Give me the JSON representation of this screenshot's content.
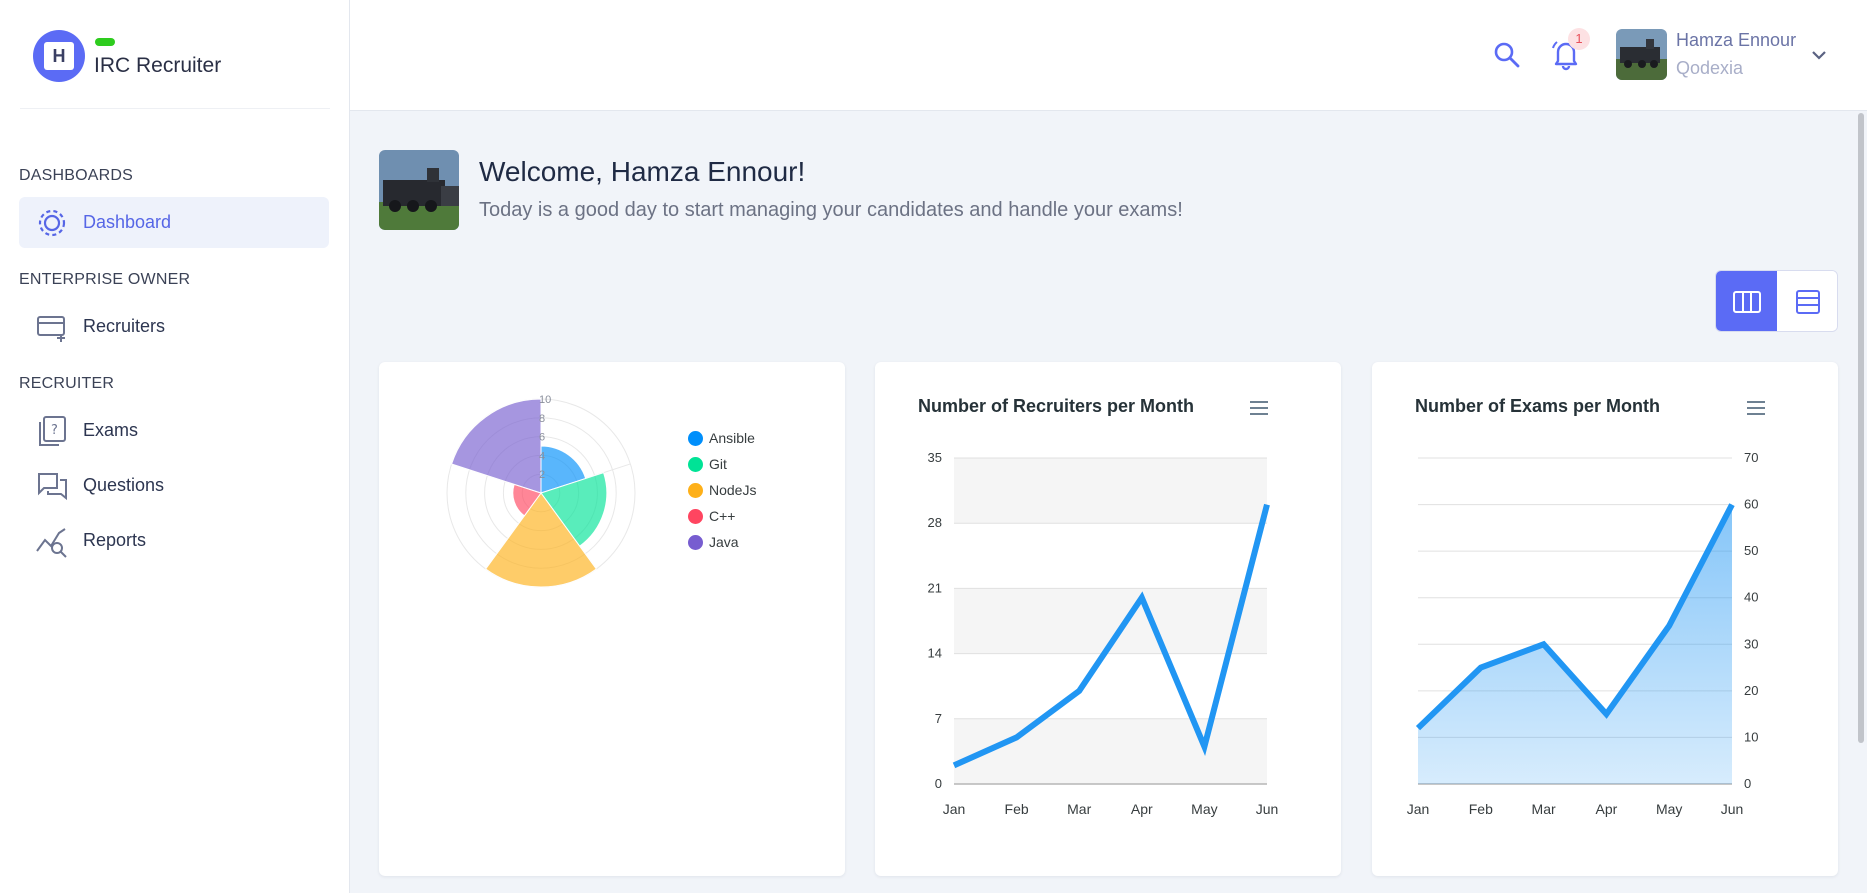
{
  "app": {
    "name": "IRC Recruiter"
  },
  "sidebar": {
    "sections": [
      {
        "title": "DASHBOARDS",
        "items": [
          {
            "label": "Dashboard",
            "icon": "gear-icon",
            "active": true
          }
        ]
      },
      {
        "title": "ENTERPRISE OWNER",
        "items": [
          {
            "label": "Recruiters",
            "icon": "card-add-icon"
          }
        ]
      },
      {
        "title": "RECRUITER",
        "items": [
          {
            "label": "Exams",
            "icon": "question-doc-icon"
          },
          {
            "label": "Questions",
            "icon": "chat-bubbles-icon"
          },
          {
            "label": "Reports",
            "icon": "chart-search-icon"
          }
        ]
      }
    ]
  },
  "topbar": {
    "notification_count": "1",
    "user_name": "Hamza Ennour",
    "organization": "Qodexia"
  },
  "welcome": {
    "title": "Welcome, Hamza Ennour!",
    "subtitle": "Today is a good day to start managing your candidates and handle your exams!"
  },
  "colors": {
    "accent": "#5b6bf5",
    "line": "#2196f3",
    "ansible": "#008ffb",
    "git": "#00e396",
    "nodejs": "#feb019",
    "cpp": "#ff4560",
    "java": "#775dd0"
  },
  "chart_data": [
    {
      "type": "polar-area",
      "labels": [
        "Ansible",
        "Git",
        "NodeJs",
        "C++",
        "Java"
      ],
      "values": [
        5,
        7,
        10,
        3,
        10
      ],
      "ylim": [
        0,
        10
      ],
      "tick_labels": [
        "0",
        "2",
        "4",
        "6",
        "8",
        "10"
      ]
    },
    {
      "type": "line",
      "title": "Number of Recruiters per Month",
      "categories": [
        "Jan",
        "Feb",
        "Mar",
        "Apr",
        "May",
        "Jun"
      ],
      "series": [
        {
          "values": [
            2,
            5,
            10,
            20,
            4,
            30
          ]
        }
      ],
      "ylim": [
        0,
        35
      ],
      "yticks": [
        0,
        7,
        14,
        21,
        28,
        35
      ],
      "y_axis_side": "left",
      "grid": true
    },
    {
      "type": "area",
      "title": "Number of Exams per Month",
      "categories": [
        "Jan",
        "Feb",
        "Mar",
        "Apr",
        "May",
        "Jun"
      ],
      "series": [
        {
          "values": [
            12,
            25,
            30,
            15,
            34,
            60
          ]
        }
      ],
      "ylim": [
        0,
        70
      ],
      "yticks": [
        0,
        10,
        20,
        30,
        40,
        50,
        60,
        70
      ],
      "y_axis_side": "right",
      "grid": true
    }
  ]
}
